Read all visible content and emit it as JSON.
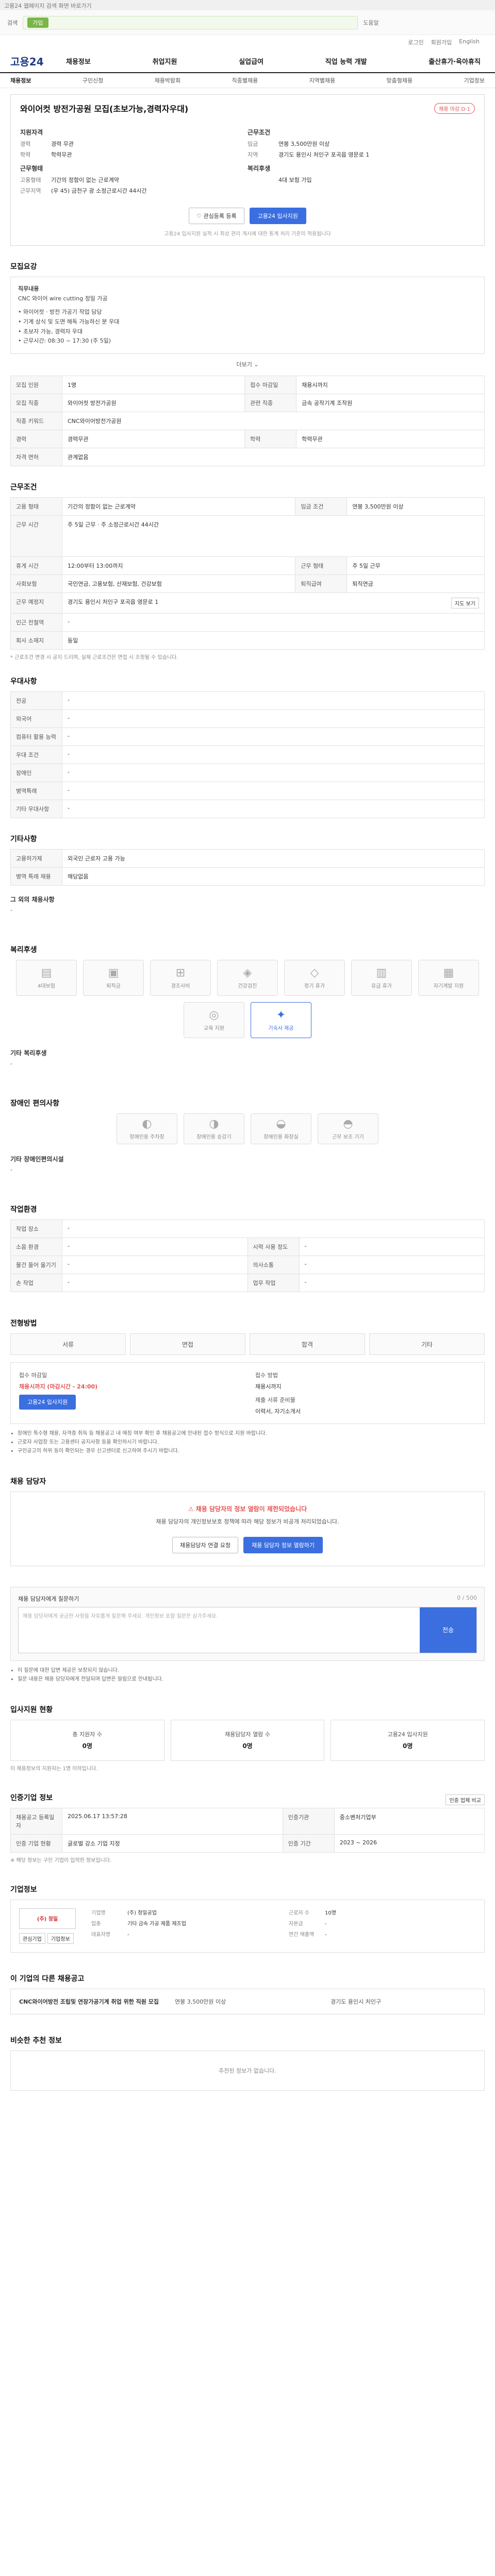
{
  "topbar": {
    "text": "고용24 웹페이지 검색 화면 바로가기"
  },
  "searchbar": {
    "label": "검색",
    "go_label": "가입",
    "help_link": "도움말"
  },
  "util": [
    "로그인",
    "회원가입",
    "English"
  ],
  "brand": {
    "logo": "고용24"
  },
  "gnb": [
    "채용정보",
    "취업지원",
    "실업급여",
    "직업 능력 개발",
    "출산휴가·육아휴직"
  ],
  "subnav": [
    "채용정보",
    "구인신청",
    "채용박람회",
    "직종별채용",
    "지역별채용",
    "맞춤형채용",
    "기업정보"
  ],
  "job": {
    "title": "와이어컷 방전가공원 모집(초보가능,경력자우대)",
    "badge": "채용 마감 D-1",
    "left_head": "지원자격",
    "left_rows": [
      {
        "k": "경력",
        "v": "경력 무관"
      },
      {
        "k": "학력",
        "v": "학력무관"
      }
    ],
    "left_head2": "근무형태",
    "left_rows2": [
      {
        "k": "고용형태",
        "v": "기간의 정함이 없는 근로계약"
      },
      {
        "k": "근무지역",
        "v": "(우 45) 금천구 광 소정근로시간 44시간"
      }
    ],
    "right_head": "근무조건",
    "right_rows": [
      {
        "k": "임금",
        "v": "연봉 3,500만원 이상"
      },
      {
        "k": "지역",
        "v": "경기도 용인시 처인구 포곡읍 영문로 1"
      }
    ],
    "right_head2": "복리후생",
    "right_rows2": [
      {
        "k": "",
        "v": "4대 보험 가입"
      }
    ],
    "interest_btn": "관심등록 등록",
    "apply_btn": "고용24 입사지원",
    "note": "고용24 입사지원 실적 시 최상 관리 게시에 대한 통계 처리 기준이 적용됩니다"
  },
  "detail": {
    "heading": "모집요강",
    "desc_lines": [
      "직무내용",
      "CNC 와이어 wire cutting 정밀 가공",
      "",
      "• 와이어컷 · 방전 가공기 작업 담당",
      "• 기계 상식 및 도면 해독 가능하신 분 우대",
      "• 초보자 가능, 경력자 우대",
      "• 근무시간: 08:30 ~ 17:30 (주 5일)"
    ],
    "more": "더보기",
    "rows": [
      [
        {
          "k": "모집 인원",
          "v": "1명"
        },
        {
          "k": "접수 마감일",
          "v": "채용시까지"
        }
      ],
      [
        {
          "k": "모집 직종",
          "v": "와이어컷 방전가공원"
        },
        {
          "k": "관련 직종",
          "v": "금속 공작기계 조작원"
        }
      ],
      [
        {
          "k": "직종 키워드",
          "v": "CNC와이어방전가공원"
        },
        {
          "k": "",
          "v": ""
        }
      ],
      [
        {
          "k": "경력",
          "v": "경력무관"
        },
        {
          "k": "학력",
          "v": "학력무관"
        }
      ],
      [
        {
          "k": "자격 면허",
          "v": "관계없음"
        },
        {
          "k": "",
          "v": ""
        }
      ]
    ]
  },
  "work": {
    "heading": "근무조건",
    "rows": [
      [
        {
          "k": "고용 형태",
          "v": "기간의 정함이 없는 근로계약"
        },
        {
          "k": "임금 조건",
          "v": "연봉 3,500만원 이상"
        }
      ],
      [
        {
          "k": "근무 시간",
          "v": "주 5일 근무 · 주 소정근로시간 44시간"
        },
        {
          "k": "",
          "v": ""
        }
      ],
      [
        {
          "k": "휴게 시간",
          "v": "12:00부터 13:00까지"
        },
        {
          "k": "근무 형태",
          "v": "주 5일 근무"
        }
      ],
      [
        {
          "k": "사회보험",
          "v": "국민연금, 고용보험, 산재보험, 건강보험"
        },
        {
          "k": "퇴직급여",
          "v": "퇴직연금"
        }
      ],
      [
        {
          "k": "근무 예정지",
          "v": "경기도 용인시 처인구 포곡읍 영문로 1"
        },
        {
          "k": "",
          "v": ""
        }
      ],
      [
        {
          "k": "인근 전철역",
          "v": "-"
        },
        {
          "k": "",
          "v": ""
        }
      ],
      [
        {
          "k": "회사 소재지",
          "v": "동일"
        },
        {
          "k": "",
          "v": ""
        }
      ]
    ],
    "map_btn": "지도 보기",
    "fine": "* 근로조건 변경 시 공지 드리며, 실제 근로조건은 면접 시 조정될 수 있습니다."
  },
  "pref": {
    "heading": "우대사항",
    "rows": [
      {
        "k": "전공",
        "v": "-"
      },
      {
        "k": "외국어",
        "v": "-"
      },
      {
        "k": "컴퓨터 활용 능력",
        "v": "-"
      },
      {
        "k": "우대 조건",
        "v": "-"
      },
      {
        "k": "장애인",
        "v": "-"
      },
      {
        "k": "병역특례",
        "v": "-"
      },
      {
        "k": "기타 우대사항",
        "v": "-"
      }
    ]
  },
  "etc": {
    "heading": "기타사항",
    "rows": [
      {
        "k": "고용허가제",
        "v": "외국인 근로자 고용 가능"
      },
      {
        "k": "병역 특례 채용",
        "v": "해당없음"
      }
    ],
    "other_head": "그 외의 채용사항",
    "other_val": "-"
  },
  "welfare": {
    "heading": "복리후생",
    "icons": [
      {
        "icon": "▤",
        "label": "4대보험",
        "on": false
      },
      {
        "icon": "▣",
        "label": "퇴직금",
        "on": false
      },
      {
        "icon": "⊞",
        "label": "경조사비",
        "on": false
      },
      {
        "icon": "◈",
        "label": "건강검진",
        "on": false
      },
      {
        "icon": "◇",
        "label": "정기 휴가",
        "on": false
      },
      {
        "icon": "▥",
        "label": "유급 휴가",
        "on": false
      },
      {
        "icon": "▦",
        "label": "자기계발 지원",
        "on": false
      },
      {
        "icon": "◎",
        "label": "교육 지원",
        "on": false
      },
      {
        "icon": "✦",
        "label": "기숙사 제공",
        "on": true
      }
    ],
    "extra_head": "기타 복리후생",
    "extra_val": "-"
  },
  "disabled": {
    "heading": "장애인 편의사항",
    "icons": [
      {
        "icon": "◐",
        "label": "장애인용 주차장"
      },
      {
        "icon": "◑",
        "label": "장애인용 승강기"
      },
      {
        "icon": "◒",
        "label": "장애인용 화장실"
      },
      {
        "icon": "◓",
        "label": "근무 보조 기기"
      }
    ],
    "extra_head": "기타 장애인편의시설",
    "extra_val": "-"
  },
  "env": {
    "heading": "작업환경",
    "rows": [
      [
        {
          "k": "작업 장소",
          "v": "-"
        },
        {
          "k": "",
          "v": ""
        }
      ],
      [
        {
          "k": "소음 환경",
          "v": "-"
        },
        {
          "k": "시력 사용 정도",
          "v": "-"
        }
      ],
      [
        {
          "k": "물건 들어 옮기기",
          "v": "-"
        },
        {
          "k": "의사소통",
          "v": "-"
        }
      ],
      [
        {
          "k": "손 작업",
          "v": "-"
        },
        {
          "k": "업무 작업",
          "v": "-"
        }
      ]
    ]
  },
  "process": {
    "heading": "전형방법",
    "steps": [
      "서류",
      "면접",
      "합격",
      "기타"
    ],
    "apply_head": "접수 마감일",
    "apply_val": "채용시까지 (마감시간 - 24:00)",
    "apply_btn": "고용24 입사지원",
    "doc_head": "접수 방법",
    "doc_val": "채용시까지",
    "doc_head2": "제출 서류 준비물",
    "doc_val2": "이력서, 자기소개서",
    "notes": [
      "장애인 특수형 채용, 자격증 취득 등 채용공고 내 매칭 여부 확인 후 채용공고에 안내된 접수 방식으로 지원 바랍니다.",
      "근로자 사업장 또는 고용센터 공지사항 등을 확인하시기 바랍니다.",
      "구인공고의 허위 등이 확인되는 경우 신고센터로 신고하여 주시기 바랍니다."
    ]
  },
  "contact": {
    "heading": "채용 담당자",
    "alert_title": "채용 담당자의 정보 열람이 제한되었습니다",
    "alert_text": "채용 담당자의 개인정보보호 정책에 따라 해당 정보가 비공개 처리되었습니다.",
    "btn1": "채용담당자 연결 요청",
    "btn2": "채용 담당자 정보 열람하기"
  },
  "qa": {
    "heading": "채용 담당자에게 질문하기",
    "counter": "0 / 500",
    "placeholder": "채용 담당자에게 궁금한 사항을 자유롭게 질문해 주세요. 개인정보 포함 질문은 삼가주세요.",
    "send": "전송",
    "notes": [
      "이 질문에 대한 답변 제공은 보장되지 않습니다.",
      "질문 내용은 채용 담당자에게 전달되며 답변은 알림으로 안내됩니다."
    ]
  },
  "status": {
    "heading": "입사지원 현황",
    "cards": [
      {
        "label": "총 지원자 수",
        "value": "0명"
      },
      {
        "label": "채용담당자 열람 수",
        "value": "0명"
      },
      {
        "label": "고용24 입사지원",
        "value": "0명"
      }
    ],
    "note": "이 채용정보의 지원자는 1명 이하입니다."
  },
  "company": {
    "heading": "인증기업 정보",
    "btn": "인증 업체 비교",
    "rows": [
      [
        {
          "k": "채용공고 등록일자",
          "v": "2025.06.17 13:57:28"
        },
        {
          "k": "인증기관",
          "v": "중소벤처기업부"
        }
      ],
      [
        {
          "k": "인증 기업 현황",
          "v": "글로벌 강소 기업 지정"
        },
        {
          "k": "인증 기간",
          "v": "2023 ~ 2026"
        }
      ]
    ],
    "fine": "※ 해당 정보는 구인 기업이 입력한 정보입니다."
  },
  "corp": {
    "heading": "기업정보",
    "logo": "(주) 정밀",
    "b1": "관심기업",
    "b2": "기업정보",
    "rows": [
      {
        "k": "기업명",
        "v": "(주) 정밀공업"
      },
      {
        "k": "업종",
        "v": "기타 금속 가공 제품 제조업"
      },
      {
        "k": "대표자명",
        "v": "-"
      },
      {
        "k": "근로자 수",
        "v": "10명"
      },
      {
        "k": "자본금",
        "v": "-"
      },
      {
        "k": "연간 매출액",
        "v": "-"
      }
    ]
  },
  "more_jobs": {
    "heading": "이 기업의 다른 채용공고",
    "items": [
      {
        "title": "CNC와이어방전 조립및 연장가공기계 취업 위한 직원 모집",
        "cond": "연봉 3,500만원 이상",
        "loc": "경기도 용인시 처인구"
      }
    ]
  },
  "similar": {
    "heading": "비슷한 추천 정보",
    "empty": "추천된 정보가 없습니다."
  }
}
